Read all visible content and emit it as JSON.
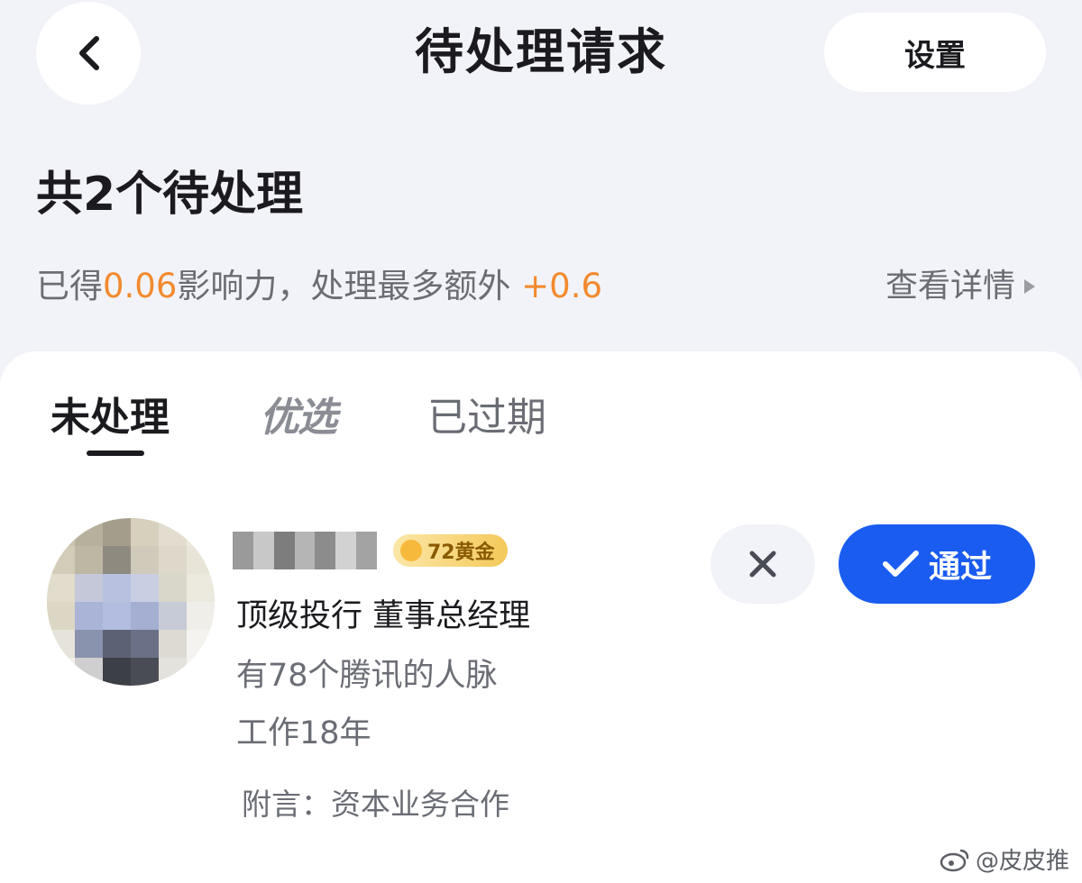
{
  "header": {
    "title": "待处理请求",
    "settings_label": "设置"
  },
  "summary": {
    "heading": "共2个待处理",
    "influence_prefix": "已得",
    "influence_value": "0.06",
    "influence_middle": "影响力，处理最多额外 ",
    "influence_extra": "+0.6",
    "view_details_label": "查看详情"
  },
  "tabs": [
    {
      "label": "未处理",
      "active": true
    },
    {
      "label": "优选",
      "active": false
    },
    {
      "label": "已过期",
      "active": false
    }
  ],
  "request": {
    "badge": "72黄金",
    "title": "顶级投行 董事总经理",
    "contacts": "有78个腾讯的人脉",
    "years": "工作18年",
    "note": "附言：资本业务合作",
    "approve_label": "通过"
  },
  "watermark": "@皮皮推",
  "colors": {
    "accent_orange": "#f28a2e",
    "primary_blue": "#1a5cf0",
    "page_background": "#f2f3f8"
  },
  "icons": {
    "back": "chevron-left-icon",
    "details": "triangle-right-icon",
    "reject": "close-icon",
    "approve": "checkmark-icon"
  }
}
